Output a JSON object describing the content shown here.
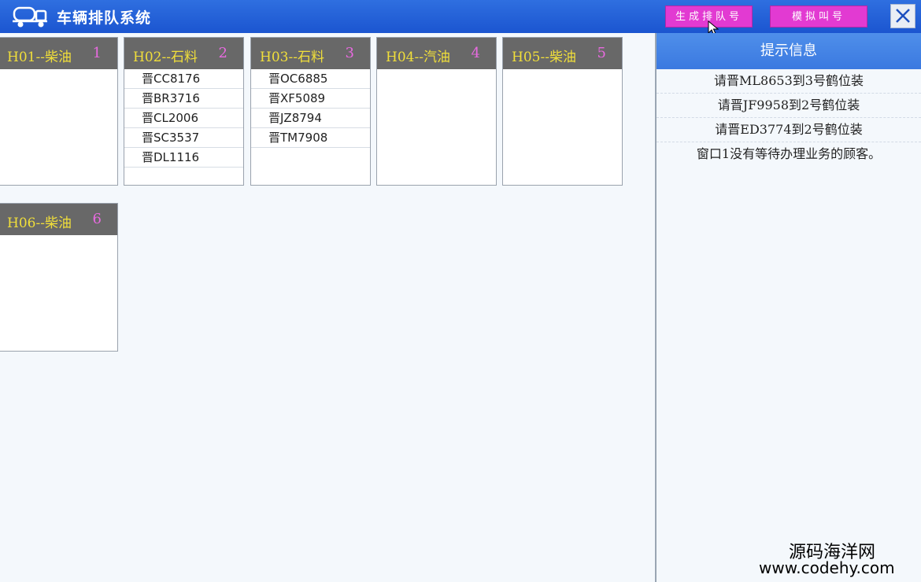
{
  "app": {
    "title": "车辆排队系统",
    "icon": "tanker-truck-icon"
  },
  "toolbar": {
    "generate_label": "生成排队号",
    "simulate_label": "模拟叫号",
    "close_icon": "close-icon",
    "button_color": "#e23ad2"
  },
  "stations": [
    {
      "title": "H01--柴油",
      "number": "1",
      "plates": []
    },
    {
      "title": "H02--石料",
      "number": "2",
      "plates": [
        "晋CC8176",
        "晋BR3716",
        "晋CL2006",
        "晋SC3537",
        "晋DL1116"
      ]
    },
    {
      "title": "H03--石料",
      "number": "3",
      "plates": [
        "晋OC6885",
        "晋XF5089",
        "晋JZ8794",
        "晋TM7908"
      ]
    },
    {
      "title": "H04--汽油",
      "number": "4",
      "plates": []
    },
    {
      "title": "H05--柴油",
      "number": "5",
      "plates": []
    },
    {
      "title": "H06--柴油",
      "number": "6",
      "plates": []
    }
  ],
  "panel": {
    "title": "提示信息",
    "messages": [
      "请晋ML8653到3号鹤位装",
      "请晋JF9958到2号鹤位装",
      "请晋ED3774到2号鹤位装",
      "窗口1没有等待办理业务的顾客。"
    ]
  },
  "watermark": {
    "line1": "源码海洋网",
    "line2": "www.codehy.com"
  },
  "colors": {
    "titlebar": "#1b55d0",
    "card_title": "#f1df3a",
    "card_number": "#e86ae0",
    "card_header": "#686868"
  }
}
